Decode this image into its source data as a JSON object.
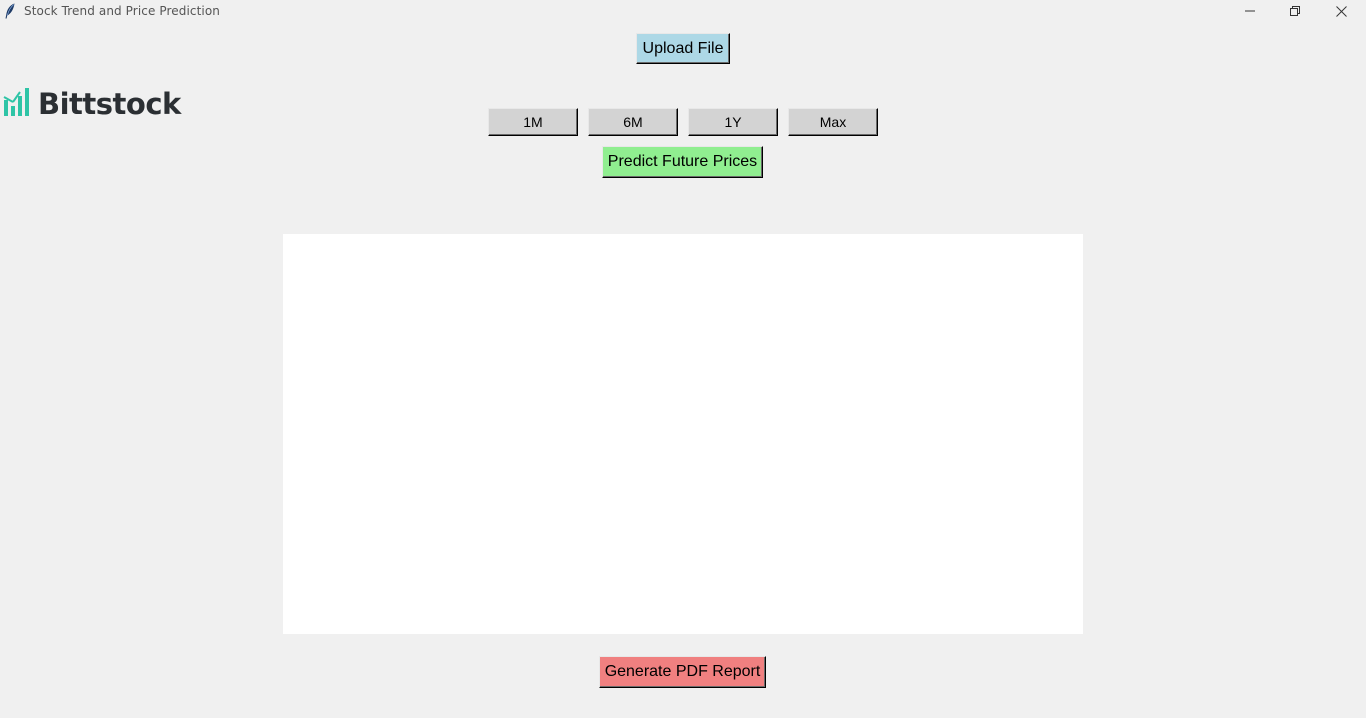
{
  "window": {
    "title": "Stock Trend and Price Prediction",
    "icons": {
      "app": "feather-icon",
      "minimize": "minimize-icon",
      "maximize": "restore-icon",
      "close": "close-icon"
    }
  },
  "logo": {
    "text": "Bittstock",
    "icon": "bar-chart-logo-icon",
    "accent_color": "#2ec4a6",
    "text_color": "#2b2f33"
  },
  "toolbar": {
    "upload_label": "Upload File",
    "ranges": [
      "1M",
      "6M",
      "1Y",
      "Max"
    ],
    "predict_label": "Predict Future Prices"
  },
  "footer": {
    "pdf_label": "Generate PDF Report"
  },
  "colors": {
    "upload_button": "#add8e6",
    "range_button": "#d3d3d3",
    "predict_button": "#90ee90",
    "pdf_button": "#f08080",
    "chart_background": "#ffffff",
    "window_background": "#f0f0f0"
  }
}
